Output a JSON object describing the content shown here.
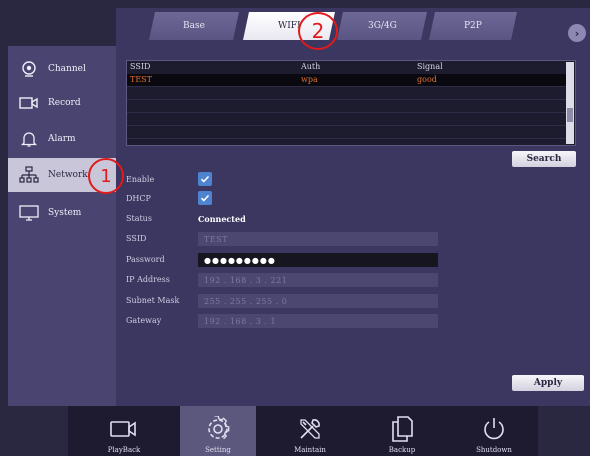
{
  "tabs": [
    {
      "label": "Base"
    },
    {
      "label": "WIFI"
    },
    {
      "label": "3G/4G"
    },
    {
      "label": "P2P"
    }
  ],
  "tab_next_arrow": "›",
  "sidebar": {
    "items": [
      {
        "label": "Channel",
        "icon": "camera-icon"
      },
      {
        "label": "Record",
        "icon": "video-record-icon"
      },
      {
        "label": "Alarm",
        "icon": "bell-icon"
      },
      {
        "label": "Network",
        "icon": "network-icon"
      },
      {
        "label": "System",
        "icon": "monitor-icon"
      }
    ],
    "active": "Network"
  },
  "wifi_table": {
    "columns": [
      "SSID",
      "Auth",
      "Signal"
    ],
    "rows": [
      {
        "ssid": "TEST",
        "auth": "wpa",
        "signal": "good"
      }
    ]
  },
  "search_button": "Search",
  "form": {
    "enable_label": "Enable",
    "enable_checked": true,
    "dhcp_label": "DHCP",
    "dhcp_checked": true,
    "status_label": "Status",
    "status_value": "Connected",
    "ssid_label": "SSID",
    "ssid_value": "TEST",
    "password_label": "Password",
    "password_value": "●●●●●●●●●",
    "ip_label": "IP Address",
    "ip_value": "192  .  168  .  3  .  221",
    "mask_label": "Subnet Mask",
    "mask_value": "255  .  255  .  255  .  0",
    "gateway_label": "Gateway",
    "gateway_value": "192  .  168  .  3  .  1"
  },
  "apply_button": "Apply",
  "dock": [
    {
      "label": "PlayBack",
      "icon": "video-camera-icon"
    },
    {
      "label": "Setting",
      "icon": "gear-icon"
    },
    {
      "label": "Maintain",
      "icon": "tools-icon"
    },
    {
      "label": "Backup",
      "icon": "copy-icon"
    },
    {
      "label": "Shutdown",
      "icon": "power-icon"
    }
  ],
  "annotations": {
    "one": "1",
    "two": "2"
  },
  "colors": {
    "background": "#2a2740",
    "panel": "#3c3760",
    "active_tab": "#ffffff",
    "selected_row_text": "#e07030",
    "checkbox": "#4e83cf",
    "annotation": "#e11a1a"
  }
}
